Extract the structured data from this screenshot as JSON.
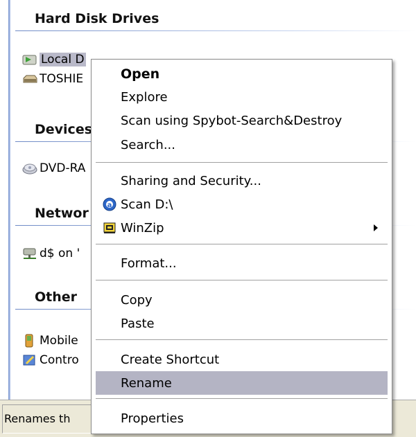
{
  "explorer": {
    "groups": [
      {
        "title": "Hard Disk Drives"
      },
      {
        "title": "Devices"
      },
      {
        "title": "Networ"
      },
      {
        "title": "Other"
      }
    ],
    "items": {
      "local_disk": "Local D",
      "toshiba": "TOSHIE",
      "dvd": "DVD-RA",
      "network_drive": "d$ on '",
      "mobile": "Mobile",
      "control": "Contro"
    },
    "status_text": "Renames th"
  },
  "context_menu": {
    "open": "Open",
    "explore": "Explore",
    "scan_spybot": "Scan using Spybot-Search&Destroy",
    "search": "Search...",
    "sharing": "Sharing and Security...",
    "scan_d": "Scan D:\\",
    "winzip": "WinZip",
    "format": "Format...",
    "copy": "Copy",
    "paste": "Paste",
    "create_shortcut": "Create Shortcut",
    "rename": "Rename",
    "properties": "Properties",
    "highlighted_item": "Rename"
  },
  "colors": {
    "menu_highlight": "#b4b4c4",
    "selection": "#b9b9c9",
    "statusbar": "#ece9d8"
  }
}
